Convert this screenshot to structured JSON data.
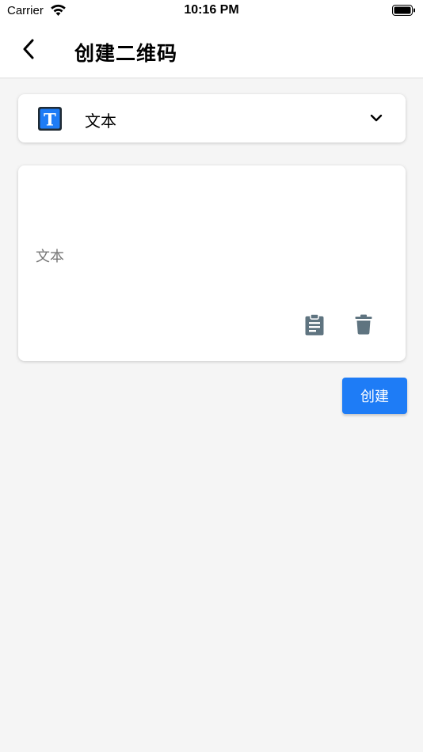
{
  "status_bar": {
    "carrier": "Carrier",
    "time": "10:16 PM",
    "icons": [
      "wifi-icon",
      "battery-icon"
    ]
  },
  "nav": {
    "title": "创建二维码",
    "back_icon": "chevron-left-icon"
  },
  "type_selector": {
    "selected_label": "文本",
    "icon": "text-type-icon",
    "icon_letter": "T",
    "expand_icon": "chevron-down-icon"
  },
  "input": {
    "value": "",
    "placeholder": "文本",
    "actions": [
      "clipboard-icon",
      "trash-icon"
    ]
  },
  "create_button": {
    "label": "创建"
  },
  "colors": {
    "accent": "#1e7cf6",
    "icon_gray": "#5f7480",
    "background": "#f5f5f5"
  }
}
